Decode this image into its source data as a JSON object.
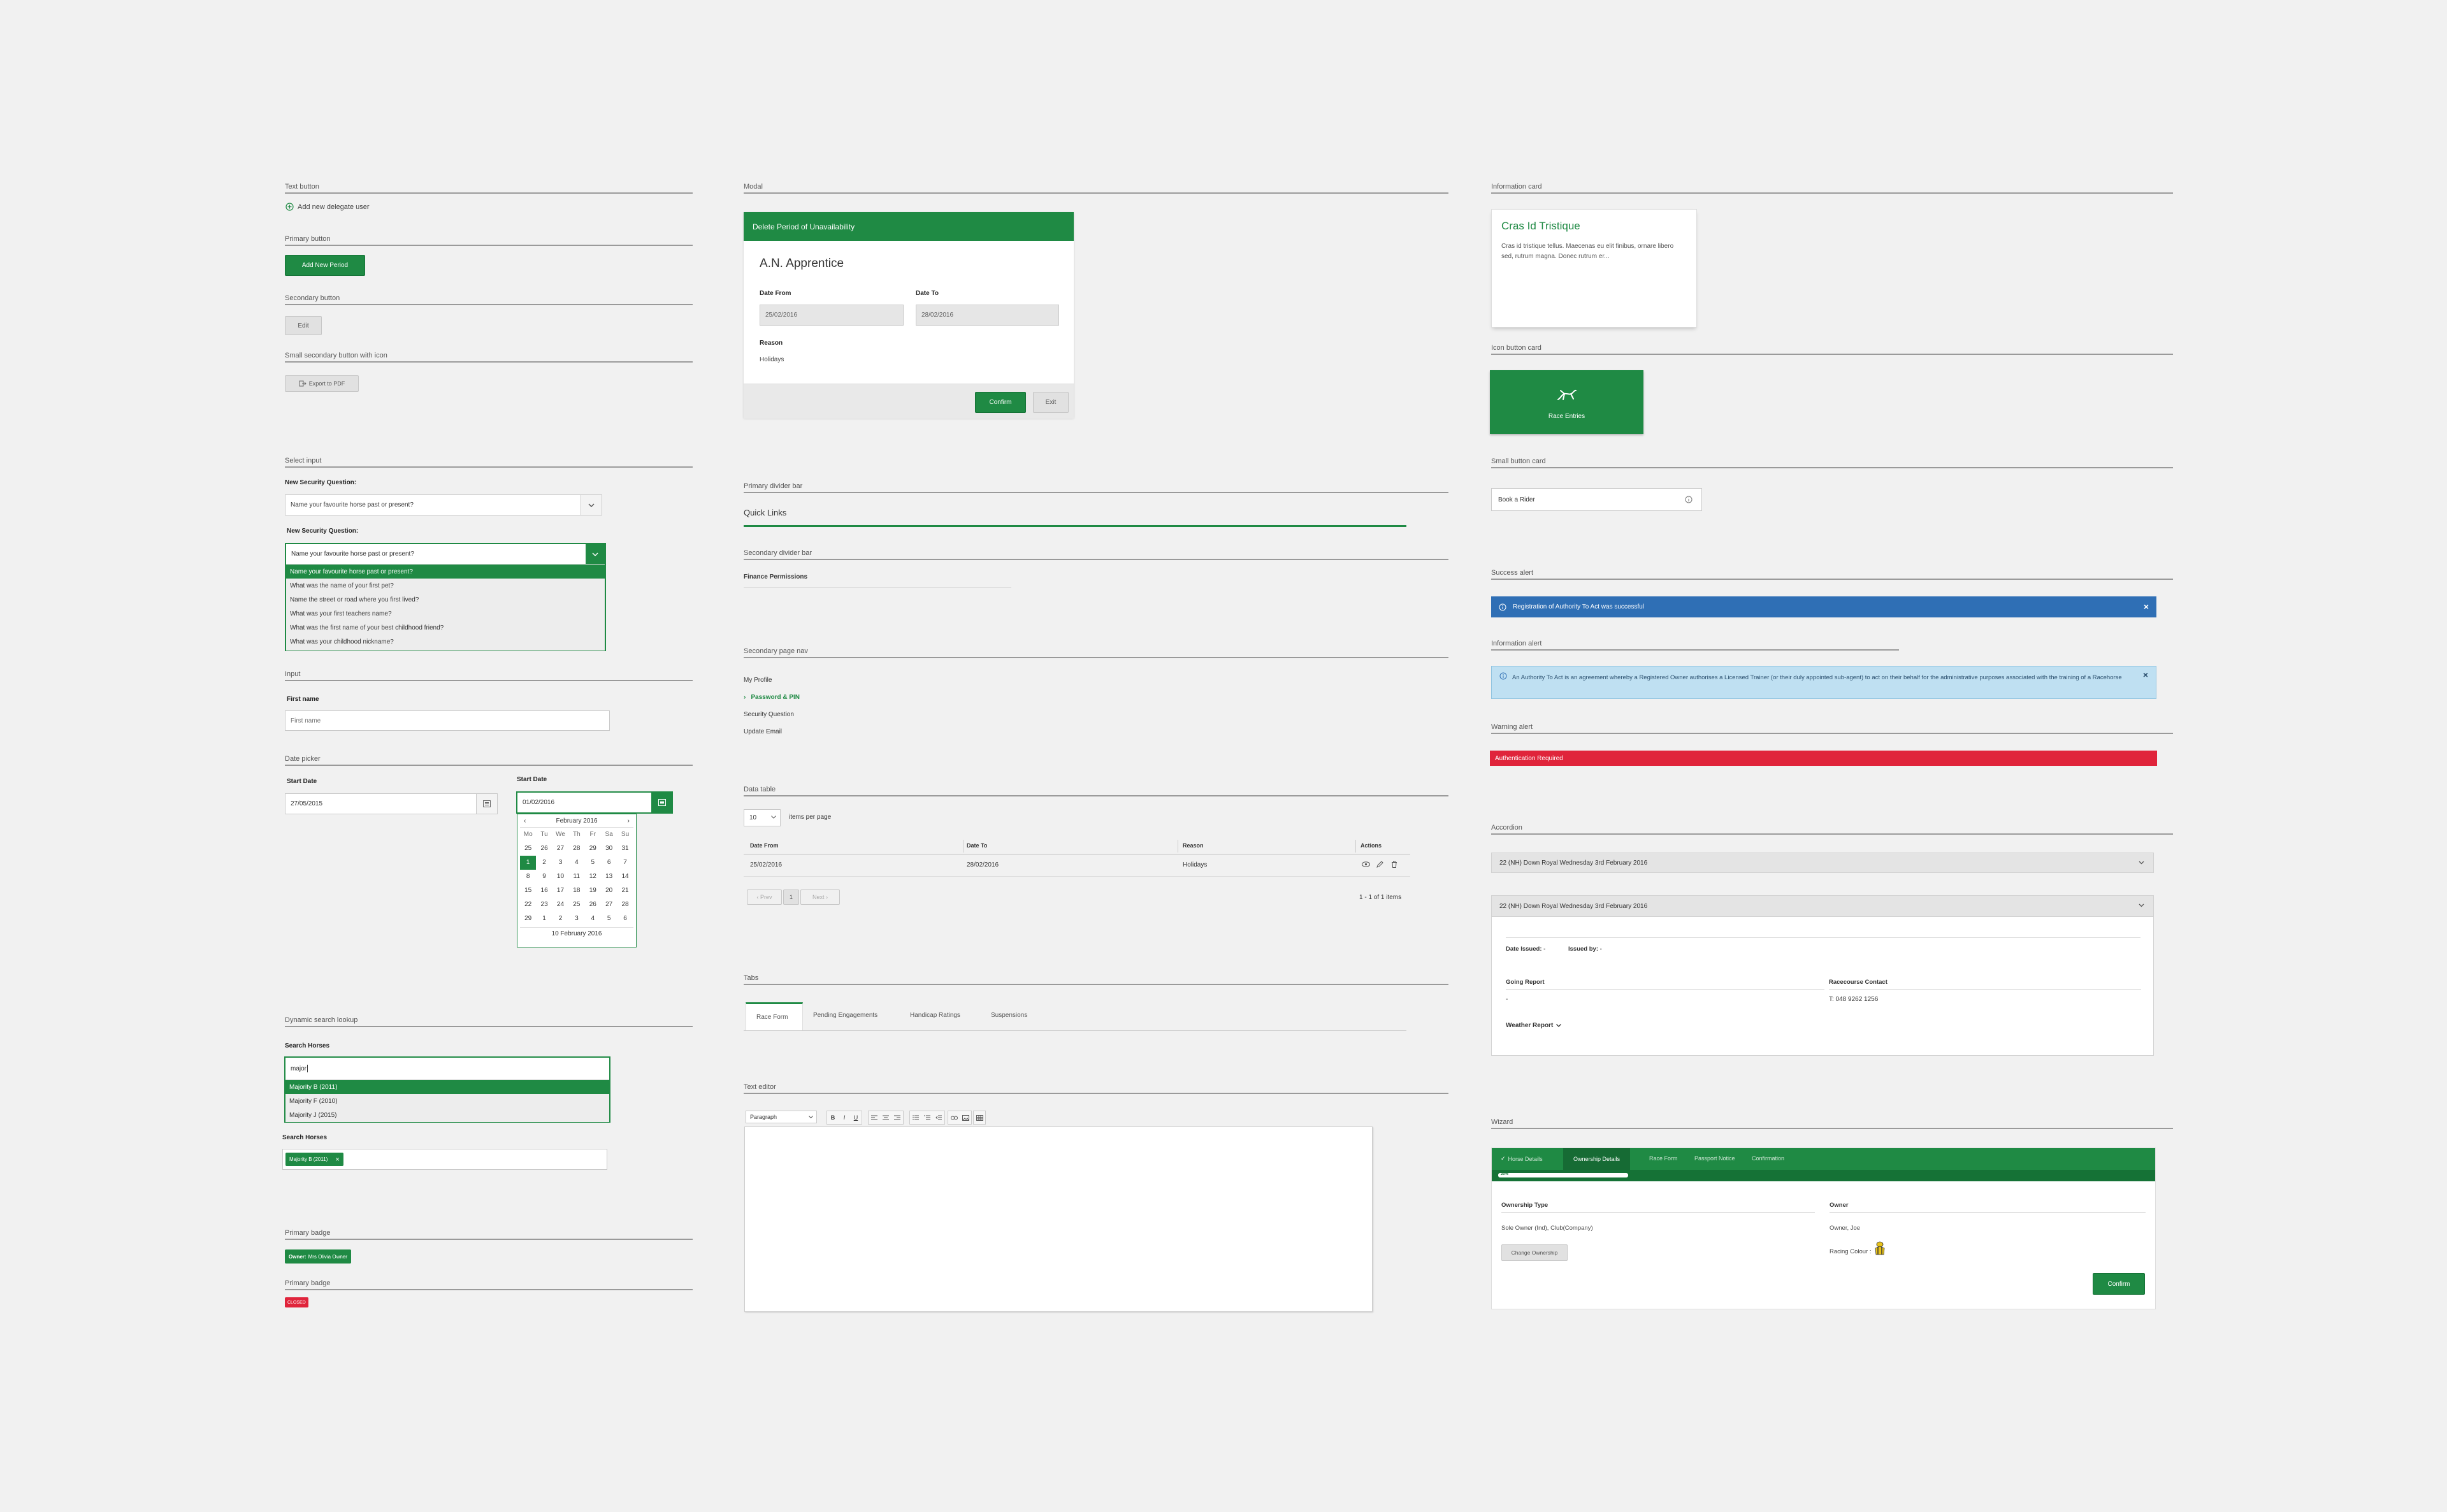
{
  "sections": {
    "text_button": "Text button",
    "primary_button": "Primary button",
    "secondary_button": "Secondary button",
    "small_secondary": "Small secondary button with icon",
    "select_input": "Select input",
    "input": "Input",
    "date_picker": "Date picker",
    "dynamic_search": "Dynamic search lookup",
    "primary_badge_1": "Primary badge",
    "primary_badge_2": "Primary badge",
    "modal": "Modal",
    "primary_divider": "Primary divider bar",
    "secondary_divider": "Secondary divider bar",
    "secondary_page_nav": "Secondary page nav",
    "data_table": "Data table",
    "tabs": "Tabs",
    "text_editor": "Text editor",
    "information_card": "Information card",
    "icon_button_card": "Icon button card",
    "small_button_card": "Small button card",
    "success_alert": "Success alert",
    "information_alert": "Information alert",
    "warning_alert": "Warning alert",
    "accordion": "Accordion",
    "wizard": "Wizard"
  },
  "buttons": {
    "text_button": "Add new delegate user",
    "primary": "Add New Period",
    "secondary": "Edit",
    "small_secondary": "Export to PDF"
  },
  "select": {
    "label": "New Security Question:",
    "value": "Name your favourite horse past or present?",
    "label2": "New Security Question:",
    "value2": "Name your favourite horse past or present?",
    "options": [
      "Name your favourite horse past or present?",
      "What was the name of your first pet?",
      "Name the street or road where you first lived?",
      "What was your first teachers name?",
      "What was the first name of your best childhood friend?",
      "What was your childhood nickname?"
    ]
  },
  "input": {
    "label": "First name",
    "placeholder": "First name"
  },
  "datepicker": {
    "label1": "Start Date",
    "value1": "27/05/2015",
    "label2": "Start Date",
    "value2": "01/02/2016",
    "month": "February 2016",
    "prev": "‹",
    "next": "›",
    "weekdays": [
      "Mo",
      "Tu",
      "We",
      "Th",
      "Fr",
      "Sa",
      "Su"
    ],
    "days": [
      "25",
      "26",
      "27",
      "28",
      "29",
      "30",
      "31",
      "1",
      "2",
      "3",
      "4",
      "5",
      "6",
      "7",
      "8",
      "9",
      "10",
      "11",
      "12",
      "13",
      "14",
      "15",
      "16",
      "17",
      "18",
      "19",
      "20",
      "21",
      "22",
      "23",
      "24",
      "25",
      "26",
      "27",
      "28",
      "29",
      "1",
      "2",
      "3",
      "4",
      "5",
      "6"
    ],
    "selected_index": 7,
    "footer": "10 February 2016"
  },
  "search": {
    "label": "Search Horses",
    "value": "major",
    "results": [
      "Majority B (2011)",
      "Majority F (2010)",
      "Majority J (2015)"
    ],
    "label2": "Search Horses",
    "tag": "Majority B (2011)",
    "tag_close": "×"
  },
  "badges": {
    "badge1_prefix": "Owner:",
    "badge1_name": "Mrs Olivia Owner",
    "badge2": "CLOSED"
  },
  "modal": {
    "header": "Delete Period of Unavailability",
    "title": "A.N. Apprentice",
    "date_from_label": "Date From",
    "date_from": "25/02/2016",
    "date_to_label": "Date To",
    "date_to": "28/02/2016",
    "reason_label": "Reason",
    "reason": "Holidays",
    "confirm": "Confirm",
    "exit": "Exit"
  },
  "dividers": {
    "primary": "Quick Links",
    "secondary": "Finance Permissions"
  },
  "page_nav": {
    "items": [
      "My Profile",
      "Password & PIN",
      "Security Question",
      "Update Email"
    ],
    "active_index": 1,
    "chevron": "›"
  },
  "table": {
    "per_page_value": "10",
    "per_page_label": "items per page",
    "headers": [
      "Date From",
      "Date To",
      "Reason",
      "Actions"
    ],
    "rows": [
      [
        "25/02/2016",
        "28/02/2016",
        "Holidays"
      ]
    ],
    "prev": "‹ Prev",
    "page": "1",
    "next": "Next ›",
    "count": "1 - 1 of 1 items"
  },
  "tabs": [
    "Race Form",
    "Pending Engagements",
    "Handicap Ratings",
    "Suspensions"
  ],
  "editor": {
    "format": "Paragraph",
    "bold": "B",
    "italic": "I",
    "underline": "U"
  },
  "info_card": {
    "title": "Cras Id Tristique",
    "body": "Cras id tristique tellus. Maecenas eu elit finibus, ornare libero sed, rutrum magna. Donec rutrum er..."
  },
  "icon_card": {
    "label": "Race Entries"
  },
  "small_card": {
    "label": "Book a Rider"
  },
  "alerts": {
    "success": "Registration of Authority To Act was successful",
    "info": "An Authority To Act is an agreement whereby a Registered Owner authorises a Licensed Trainer (or their duly appointed sub-agent) to act on their behalf for the administrative purposes associated with the training of a Racehorse",
    "warning": "Authentication Required",
    "close": "×"
  },
  "accordion": {
    "item1": "22 (NH) Down Royal Wednesday 3rd February 2016",
    "item2": "22 (NH) Down Royal Wednesday 3rd February 2016",
    "date_issued": "Date Issued: -",
    "issued_by": "Issued by: -",
    "going_report": "Going Report",
    "going_value": "-",
    "racecourse_contact": "Racecourse Contact",
    "contact_value": "T: 048 9262 1256",
    "weather": "Weather Report"
  },
  "wizard": {
    "steps": [
      "Horse Details",
      "Ownership Details",
      "Race Form",
      "Passport Notice",
      "Confirmation"
    ],
    "check": "✓",
    "progress_label": "20%",
    "progress": 0.2,
    "ownership_type_label": "Ownership Type",
    "ownership_type": "Sole Owner (Ind), Club(Company)",
    "change": "Change Ownership",
    "owner_label": "Owner",
    "owner": "Owner, Joe",
    "racing_colour": "Racing Colour :",
    "confirm": "Confirm"
  },
  "colors": {
    "green": "#1f8a44",
    "blue_alert": "#2f6fb5",
    "info_alert": "#bfe0f2",
    "red": "#e0243b"
  }
}
